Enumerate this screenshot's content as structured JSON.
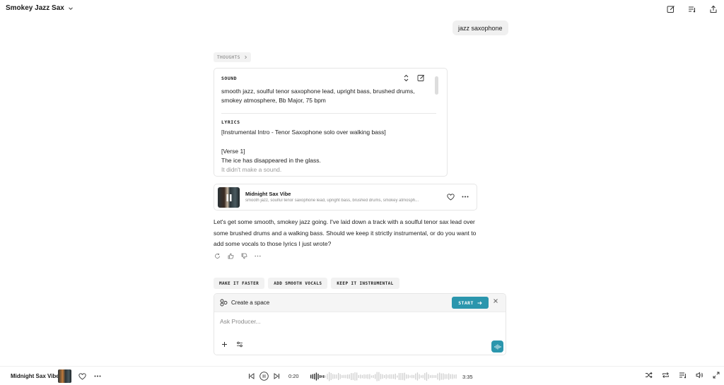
{
  "header": {
    "title": "Smokey Jazz Sax",
    "icons": [
      "new-chat-icon",
      "queue-icon",
      "share-icon"
    ]
  },
  "user_message": "jazz saxophone",
  "thoughts_label": "THOUGHTS",
  "thoughts_card": {
    "sound_label": "SOUND",
    "sound_text": "smooth jazz, soulful tenor saxophone lead, upright bass, brushed drums, smokey atmosphere, Bb Major, 75 bpm",
    "lyrics_label": "LYRICS",
    "lyrics_line1": "[Instrumental Intro - Tenor Saxophone solo over walking bass]",
    "lyrics_line2": "[Verse 1]",
    "lyrics_line3": "The ice has disappeared in the glass.",
    "lyrics_line4": "It didn't make a sound."
  },
  "track": {
    "title": "Midnight Sax Vibe",
    "description": "smooth jazz, soulful tenor saxophone lead, upright bass, brushed drums, smokey atmosph..."
  },
  "assistant_message": "Let's get some smooth, smokey jazz going. I've laid down a track with a soulful tenor sax lead over some brushed drums and a walking bass. Should we keep it strictly instrumental, or do you want to add some vocals to those lyrics I just wrote?",
  "suggestions": [
    "MAKE IT FASTER",
    "ADD SMOOTH VOCALS",
    "KEEP IT INSTRUMENTAL"
  ],
  "composer": {
    "space_label": "Create a space",
    "start_label": "START",
    "placeholder": "Ask Producer..."
  },
  "player": {
    "title": "Midnight Sax Vibe",
    "current_time": "0:20",
    "total_time": "3:35",
    "progress": 0.09
  },
  "colors": {
    "accent": "#2b96ad"
  }
}
